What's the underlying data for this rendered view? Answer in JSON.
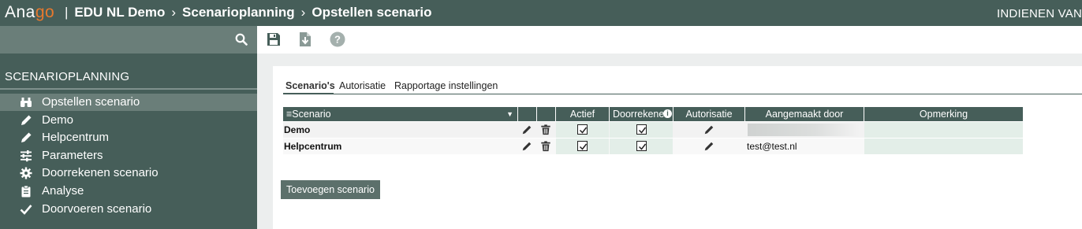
{
  "header": {
    "logo_part1": "Ana",
    "logo_part2": "go",
    "separator": "|",
    "crumb_1": "EDU NL Demo",
    "crumb_2": "Scenarioplanning",
    "crumb_3": "Opstellen scenario",
    "crumb_sep": "›",
    "right_label": "INDIENEN VAN"
  },
  "sidebar": {
    "title": "SCENARIOPLANNING",
    "items": [
      {
        "label": "Opstellen scenario",
        "icon": "binoculars-icon",
        "active": true
      },
      {
        "label": "Demo",
        "icon": "pencil-icon"
      },
      {
        "label": "Helpcentrum",
        "icon": "pencil-icon"
      },
      {
        "label": "Parameters",
        "icon": "sliders-icon"
      },
      {
        "label": "Doorrekenen scenario",
        "icon": "gear-icon"
      },
      {
        "label": "Analyse",
        "icon": "clipboard-icon"
      },
      {
        "label": "Doorvoeren scenario",
        "icon": "check-icon"
      }
    ]
  },
  "toolbar": {
    "save_icon": "save-icon",
    "download_icon": "download-icon",
    "help_icon": "help-icon"
  },
  "tabs": [
    "Scenario's",
    "Autorisatie",
    "Rapportage instellingen"
  ],
  "table": {
    "columns": [
      "Scenario",
      "",
      "",
      "Actief",
      "Doorrekenen",
      "Autorisatie",
      "Aangemaakt door",
      "Opmerking"
    ],
    "rows": [
      {
        "scenario": "Demo",
        "actief": true,
        "doorrekenen": true,
        "aangemaakt_door": "",
        "opmerking": ""
      },
      {
        "scenario": "Helpcentrum",
        "actief": true,
        "doorrekenen": true,
        "aangemaakt_door": "test@test.nl",
        "opmerking": ""
      }
    ]
  },
  "add_button": "Toevoegen scenario",
  "colors": {
    "header_bg": "#465e59",
    "accent_logo": "#e8792d",
    "active_item": "#6a7e79"
  }
}
